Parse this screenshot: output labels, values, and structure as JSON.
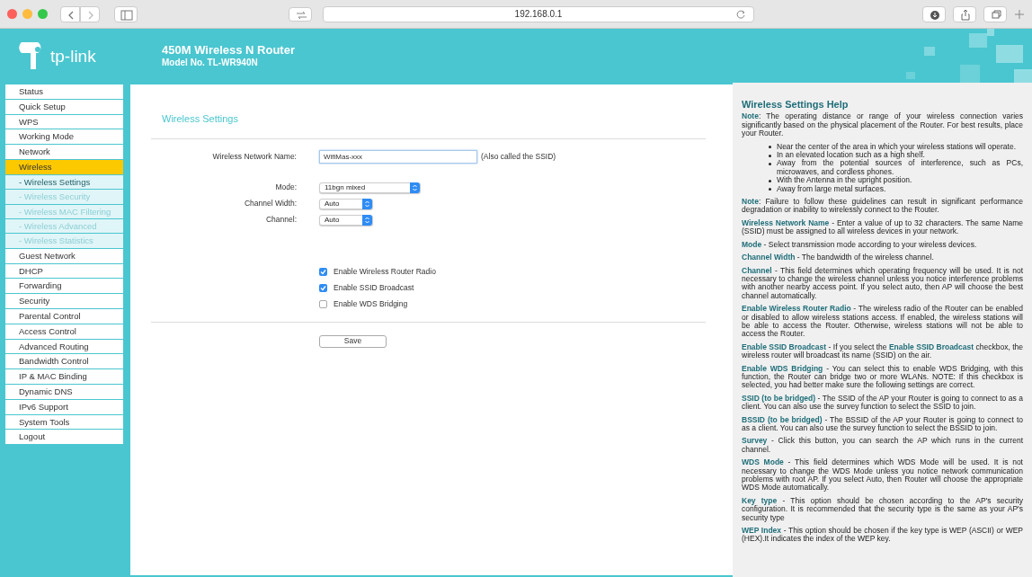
{
  "browser": {
    "url": "192.168.0.1"
  },
  "header": {
    "title": "450M Wireless N Router",
    "model": "Model No. TL-WR940N",
    "logo_text": "tp-link"
  },
  "sidebar": {
    "items": [
      {
        "label": "Status",
        "selected": false,
        "kind": "main"
      },
      {
        "label": "Quick Setup",
        "selected": false,
        "kind": "main"
      },
      {
        "label": "WPS",
        "selected": false,
        "kind": "main"
      },
      {
        "label": "Working Mode",
        "selected": false,
        "kind": "main"
      },
      {
        "label": "Network",
        "selected": false,
        "kind": "main"
      },
      {
        "label": "Wireless",
        "selected": true,
        "kind": "main"
      },
      {
        "label": "- Wireless Settings",
        "selected": true,
        "kind": "sub"
      },
      {
        "label": "- Wireless Security",
        "selected": false,
        "kind": "sub"
      },
      {
        "label": "- Wireless MAC Filtering",
        "selected": false,
        "kind": "sub"
      },
      {
        "label": "- Wireless Advanced",
        "selected": false,
        "kind": "sub"
      },
      {
        "label": "- Wireless Statistics",
        "selected": false,
        "kind": "sub"
      },
      {
        "label": "Guest Network",
        "selected": false,
        "kind": "main"
      },
      {
        "label": "DHCP",
        "selected": false,
        "kind": "main"
      },
      {
        "label": "Forwarding",
        "selected": false,
        "kind": "main"
      },
      {
        "label": "Security",
        "selected": false,
        "kind": "main"
      },
      {
        "label": "Parental Control",
        "selected": false,
        "kind": "main"
      },
      {
        "label": "Access Control",
        "selected": false,
        "kind": "main"
      },
      {
        "label": "Advanced Routing",
        "selected": false,
        "kind": "main"
      },
      {
        "label": "Bandwidth Control",
        "selected": false,
        "kind": "main"
      },
      {
        "label": "IP & MAC Binding",
        "selected": false,
        "kind": "main"
      },
      {
        "label": "Dynamic DNS",
        "selected": false,
        "kind": "main"
      },
      {
        "label": "IPv6 Support",
        "selected": false,
        "kind": "main"
      },
      {
        "label": "System Tools",
        "selected": false,
        "kind": "main"
      },
      {
        "label": "Logout",
        "selected": false,
        "kind": "main"
      }
    ]
  },
  "main": {
    "title": "Wireless Settings",
    "name_field": {
      "label": "Wireless Network Name:",
      "value": "WifiMas-xxx",
      "note": "(Also called the SSID)"
    },
    "selects": [
      {
        "label": "Mode:",
        "value": "11bgn mixed",
        "kind": "wide"
      },
      {
        "label": "Channel Width:",
        "value": "Auto",
        "kind": "narrow"
      },
      {
        "label": "Channel:",
        "value": "Auto",
        "kind": "narrow"
      }
    ],
    "checkboxes": [
      {
        "label": "Enable Wireless Router Radio",
        "checked": true
      },
      {
        "label": "Enable SSID Broadcast",
        "checked": true
      },
      {
        "label": "Enable WDS Bridging",
        "checked": false
      }
    ],
    "save_button": "Save"
  },
  "help": {
    "title": "Wireless Settings Help",
    "blocks": [
      {
        "kind": "paragraph",
        "text": "**Note**: The operating distance or range of your wireless connection varies significantly based on the physical placement of the Router. For best results, place your Router."
      },
      {
        "kind": "list",
        "items": [
          "Near the center of the area in which your wireless stations will operate.",
          "In an elevated location such as a high shelf.",
          "Away from the potential sources of interference, such as PCs, microwaves, and cordless phones.",
          "With the Antenna in the upright position.",
          "Away from large metal surfaces."
        ]
      },
      {
        "kind": "paragraph",
        "text": "**Note**: Failure to follow these guidelines can result in significant performance degradation or inability to wirelessly connect to the Router."
      },
      {
        "kind": "paragraph",
        "text": "**Wireless Network Name** - Enter a value of up to 32 characters. The same Name (SSID) must be assigned to all wireless devices in your network."
      },
      {
        "kind": "paragraph",
        "text": "**Mode** - Select transmission mode according to your wireless devices."
      },
      {
        "kind": "paragraph",
        "text": "**Channel Width** - The bandwidth of the wireless channel."
      },
      {
        "kind": "paragraph",
        "text": "**Channel** - This field determines which operating frequency will be used. It is not necessary to change the wireless channel unless you notice interference problems with another nearby access point. If you select auto, then AP will choose the best channel automatically."
      },
      {
        "kind": "paragraph",
        "text": "**Enable Wireless Router Radio** - The wireless radio of the Router can be enabled or disabled to allow wireless stations access. If enabled, the wireless stations will be able to access the Router. Otherwise, wireless stations will not be able to access the Router."
      },
      {
        "kind": "paragraph",
        "text": "**Enable SSID Broadcast** - If you select the **Enable SSID Broadcast** checkbox, the wireless router will broadcast its name (SSID) on the air."
      },
      {
        "kind": "paragraph",
        "text": "**Enable WDS Bridging** - You can select this to enable WDS Bridging, with this function, the Router can bridge two or more WLANs. NOTE: If this checkbox is selected, you had better make sure the following settings are correct."
      },
      {
        "kind": "paragraph",
        "text": "**SSID (to be bridged)** - The SSID of the AP your Router is going to connect to as a client. You can also use the survey function to select the SSID to join."
      },
      {
        "kind": "paragraph",
        "text": "**BSSID (to be bridged)** - The BSSID of the AP your Router is going to connect to as a client. You can also use the survey function to select the BSSID to join."
      },
      {
        "kind": "paragraph",
        "text": "**Survey** - Click this button, you can search the AP which runs in the current channel."
      },
      {
        "kind": "paragraph",
        "text": "**WDS Mode** - This field determines which WDS Mode will be used. It is not necessary to change the WDS Mode unless you notice network communication problems with root AP. If you select Auto, then Router will choose the appropriate WDS Mode automatically."
      },
      {
        "kind": "paragraph",
        "text": "**Key type** - This option should be chosen according to the AP's security configuration. It is recommended that the security type is the same as your AP's security type"
      },
      {
        "kind": "paragraph",
        "text": "**WEP Index** - This option should be chosen if the key type is WEP (ASCII) or WEP (HEX).It indicates the index of the WEP key."
      }
    ]
  }
}
